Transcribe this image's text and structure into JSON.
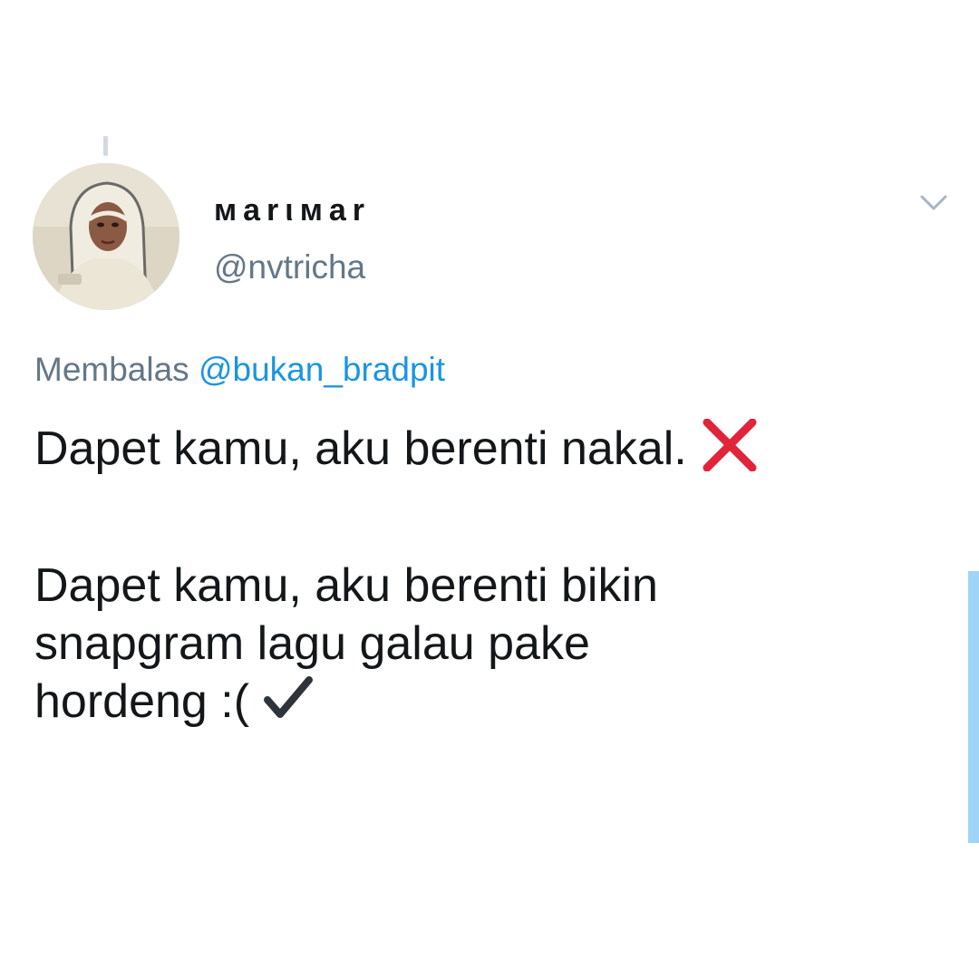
{
  "tweet": {
    "display_name": "мarιмar",
    "handle": "@nvtricha",
    "reply_prefix": "Membalas",
    "reply_to": "@bukan_bradpit",
    "lines": [
      "Dapet kamu, aku berenti nakal.",
      "Dapet kamu, aku berenti bikin",
      "snapgram lagu galau pake",
      "hordeng :("
    ],
    "icons": {
      "first_line_emoji": "cross-mark-icon",
      "last_line_emoji": "check-mark-icon",
      "menu": "chevron-down-icon"
    }
  },
  "colors": {
    "primary_text": "#14171a",
    "secondary_text": "#657786",
    "mention": "#1b95e0",
    "cross_mark": "#e0243a",
    "scrollbar": "#9fd4f6"
  }
}
